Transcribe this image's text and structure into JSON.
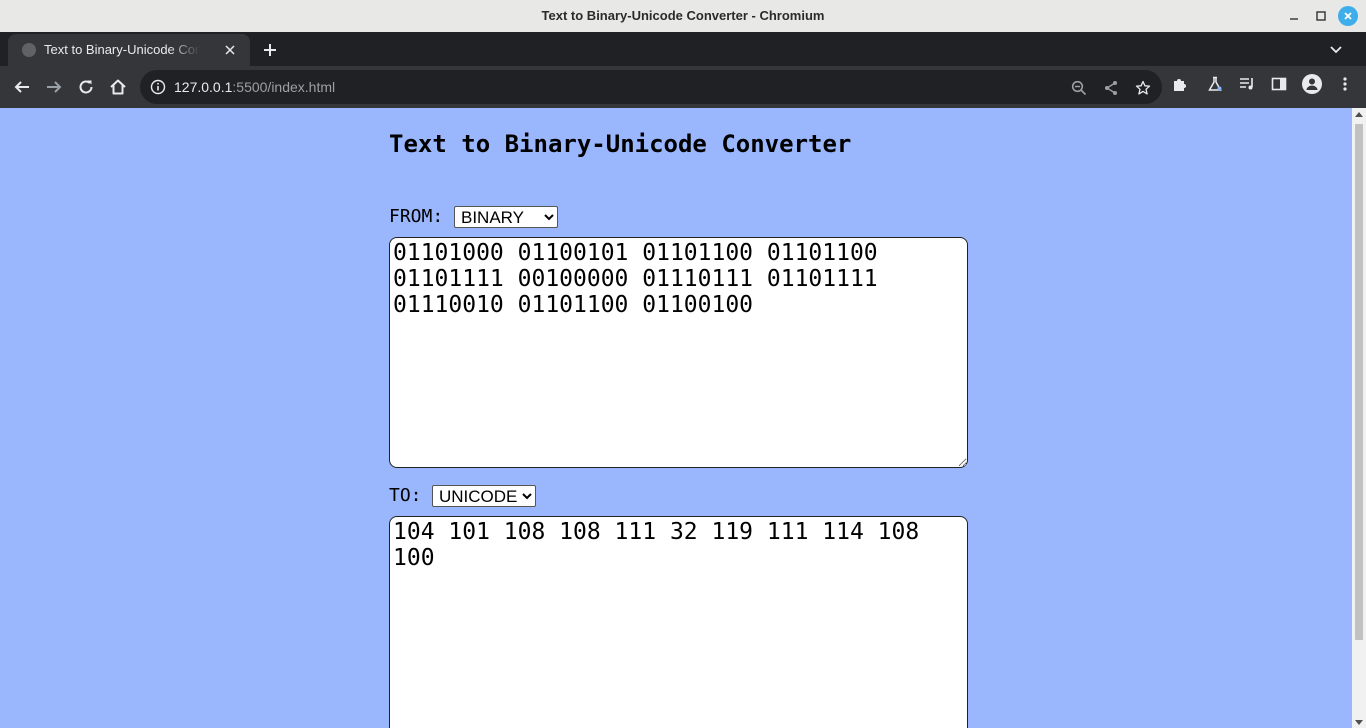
{
  "window": {
    "title": "Text to Binary-Unicode Converter - Chromium"
  },
  "tab": {
    "title": "Text to Binary-Unicode Converter"
  },
  "address_bar": {
    "host": "127.0.0.1",
    "path": ":5500/index.html"
  },
  "page": {
    "heading": "Text to Binary-Unicode Converter",
    "from_label": "FROM:",
    "from_selected": "BINARY",
    "from_options": [
      "BINARY"
    ],
    "input_text": "01101000 01100101 01101100 01101100 01101111 00100000 01110111 01101111 01110010 01101100 01100100",
    "to_label": "TO:",
    "to_selected": "UNICODE",
    "to_options": [
      "UNICODE"
    ],
    "output_text": "104 101 108 108 111 32 119 111 114 108 100"
  },
  "colors": {
    "page_background": "#9ab7fd",
    "tab_strip": "#202124",
    "toolbar": "#35363a"
  }
}
